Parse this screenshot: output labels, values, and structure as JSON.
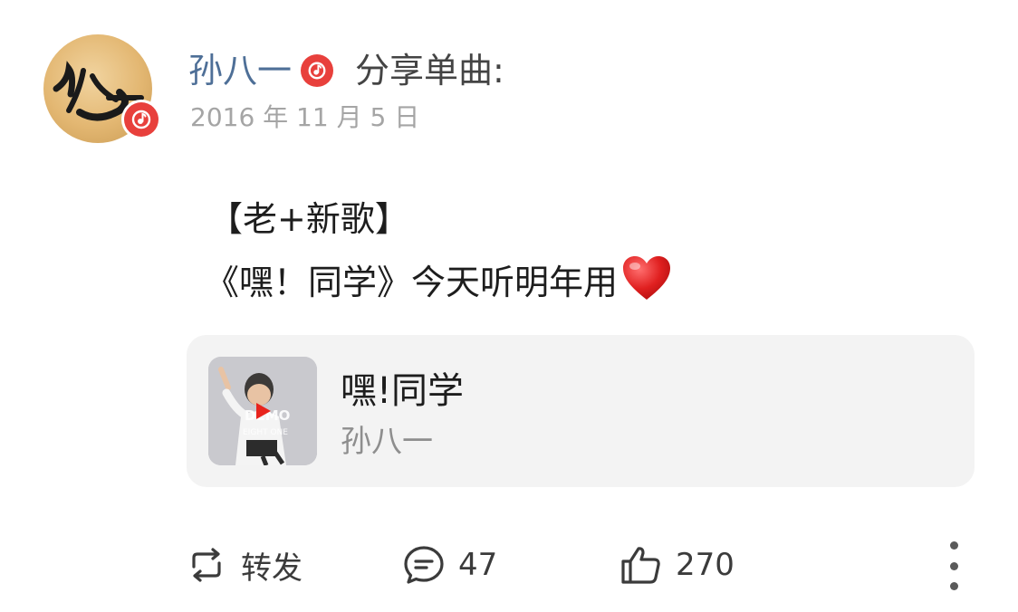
{
  "post": {
    "author": "孙八一",
    "action": "分享单曲:",
    "timestamp": "2016 年 11 月 5 日",
    "lines": [
      "【老+新歌】",
      "《嘿！同学》今天听明年用"
    ],
    "emoji": "heart"
  },
  "music_card": {
    "title": "嘿!同学",
    "artist": "孙八一",
    "icon": "play-icon"
  },
  "actions": {
    "repost_label": "转发",
    "comment_count": "47",
    "like_count": "270"
  },
  "colors": {
    "username": "#4e6f97",
    "badge_red": "#e8403c",
    "timestamp": "#a5a5a5",
    "card_bg": "#f3f3f3"
  }
}
